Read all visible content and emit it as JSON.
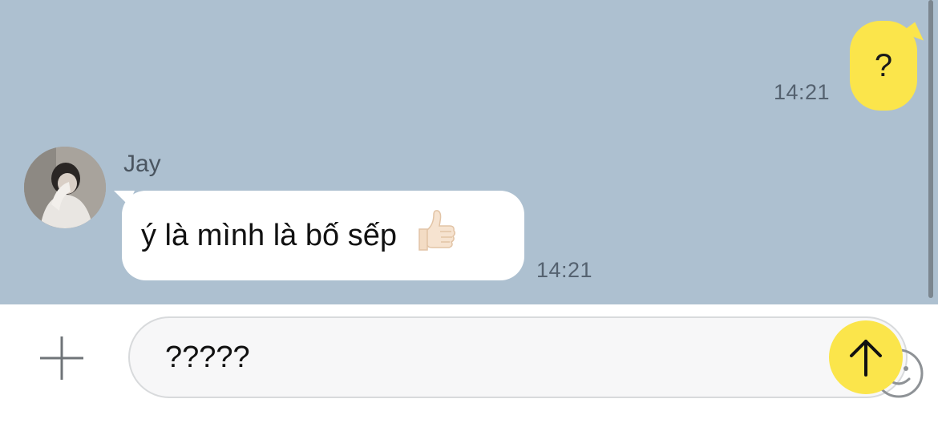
{
  "thread": {
    "outgoing": {
      "text": "?",
      "time": "14:21"
    },
    "incoming": {
      "sender": "Jay",
      "text": "ý là mình là bố sếp",
      "emoji": "👍🏻",
      "time": "14:21"
    }
  },
  "composer": {
    "value": "?????",
    "plus_icon": "plus-icon",
    "emoji_icon": "smiley-icon",
    "send_icon": "arrow-up-icon"
  },
  "colors": {
    "chat_background": "#adc0d0",
    "outgoing_bubble": "#fbe54b",
    "incoming_bubble": "#ffffff",
    "send_button": "#fbe54b"
  }
}
